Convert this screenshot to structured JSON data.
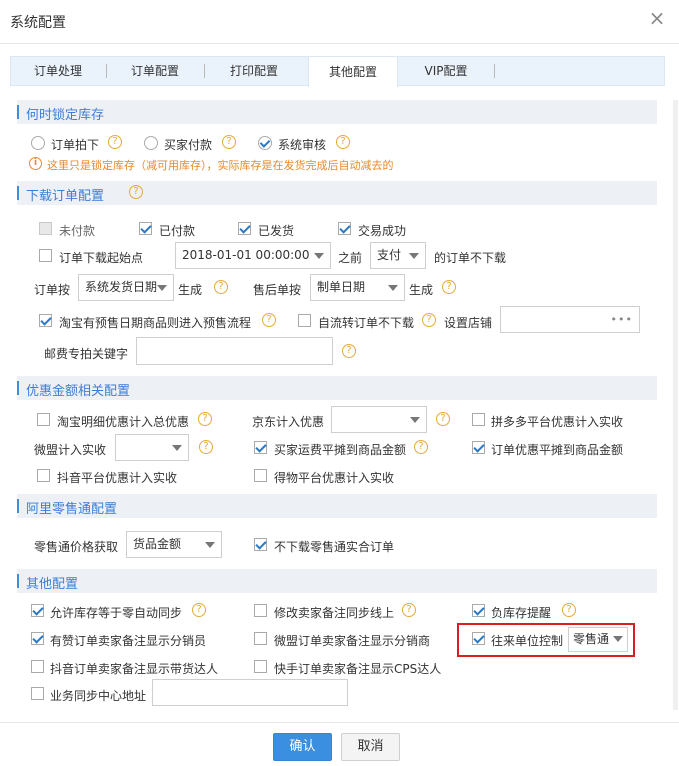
{
  "dialog": {
    "title": "系统配置",
    "confirm": "确认",
    "cancel": "取消"
  },
  "tabs": [
    "订单处理",
    "订单配置",
    "打印配置",
    "其他配置",
    "VIP配置"
  ],
  "sec1": {
    "title": "何时锁定库存",
    "opt1": "订单拍下",
    "opt2": "买家付款",
    "opt3": "系统审核",
    "warning": "这里只是锁定库存（减可用库存），实际库存是在发货完成后自动减去的"
  },
  "sec2": {
    "title": "下载订单配置",
    "unpaid": "未付款",
    "paid": "已付款",
    "shipped": "已发货",
    "success": "交易成功",
    "start_point": "订单下载起始点",
    "start_date": "2018-01-01 00:00:00",
    "before": "之前",
    "pay_option": "支付",
    "not_download": "的订单不下载",
    "order_by": "订单按",
    "order_by_value": "系统发货日期",
    "generate": "生成",
    "after_sale_by": "售后单按",
    "after_sale_value": "制单日期",
    "generate2": "生成",
    "presale": "淘宝有预售日期商品则进入预售流程",
    "auto_flow": "自流转订单不下载",
    "set_store": "设置店铺",
    "store_dots": "•••",
    "postage_keyword": "邮费专拍关键字"
  },
  "sec3": {
    "title": "优惠金额相关配置",
    "taobao_detail": "淘宝明细优惠计入总优惠",
    "jd": "京东计入优惠",
    "pdd": "拼多多平台优惠计入实收",
    "weimeng": "微盟计入实收",
    "buyer_freight": "买家运费平摊到商品金额",
    "order_discount": "订单优惠平摊到商品金额",
    "douyin": "抖音平台优惠计入实收",
    "dewu": "得物平台优惠计入实收"
  },
  "sec4": {
    "title": "阿里零售通配置",
    "price_get": "零售通价格获取",
    "price_value": "货品金额",
    "no_combined": "不下载零售通实合订单"
  },
  "sec5": {
    "title": "其他配置",
    "allow_zero": "允许库存等于零自动同步",
    "modify_remark": "修改卖家备注同步线上",
    "negative_stock": "负库存提醒",
    "youzan": "有赞订单卖家备注显示分销员",
    "weimeng_remark": "微盟订单卖家备注显示分销商",
    "contact_unit": "往来单位控制",
    "contact_value": "零售通",
    "douyin_remark": "抖音订单卖家备注显示带货达人",
    "kuaishou_remark": "快手订单卖家备注显示CPS达人",
    "sync_center": "业务同步中心地址"
  },
  "icons": {
    "question": "?",
    "close": "×",
    "warning": "i"
  },
  "colors": {
    "accent": "#3b8fe0",
    "warning": "#e8892a",
    "highlight": "#d62020"
  }
}
